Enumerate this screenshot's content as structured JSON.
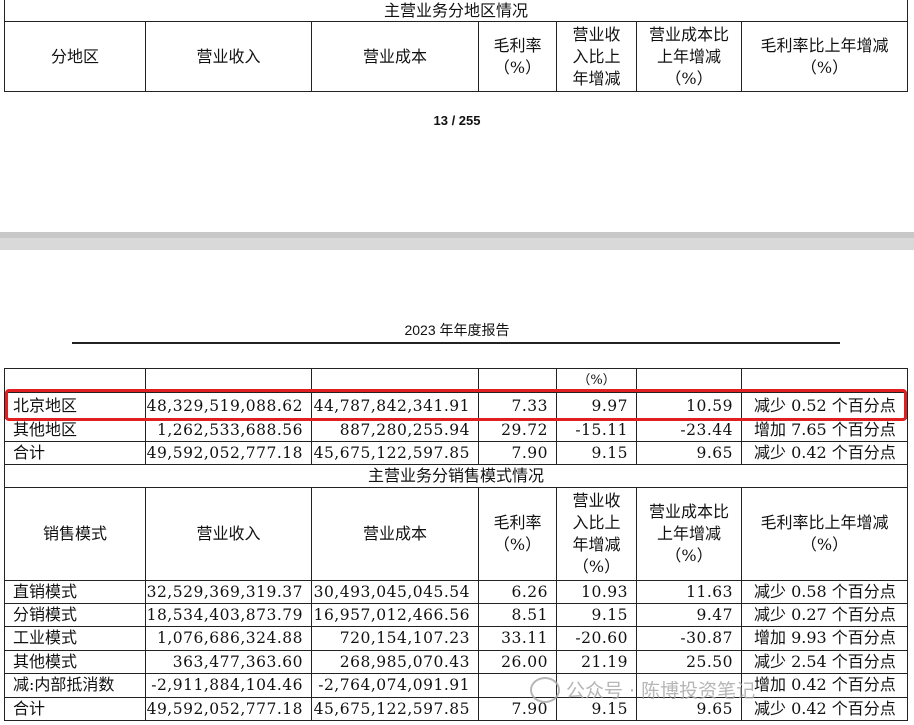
{
  "top_table": {
    "title": "主营业务分地区情况",
    "headers": [
      "分地区",
      "营业收入",
      "营业成本",
      "毛利率\n（%）",
      "营业收\n入比上\n年增减",
      "营业成本比\n上年增减\n（%）",
      "毛利率比上年增减\n（%）"
    ]
  },
  "page_number": "13 / 255",
  "report_header": "2023 年年度报告",
  "region_table": {
    "partial_header_pct": "（%）",
    "rows": [
      [
        "北京地区",
        "48,329,519,088.62",
        "44,787,842,341.91",
        "7.33",
        "9.97",
        "10.59",
        "减少 0.52 个百分点"
      ],
      [
        "其他地区",
        "1,262,533,688.56",
        "887,280,255.94",
        "29.72",
        "-15.11",
        "-23.44",
        "增加 7.65 个百分点"
      ],
      [
        "合计",
        "49,592,052,777.18",
        "45,675,122,597.85",
        "7.90",
        "9.15",
        "9.65",
        "减少 0.42 个百分点"
      ]
    ]
  },
  "sales_table": {
    "title": "主营业务分销售模式情况",
    "headers": [
      "销售模式",
      "营业收入",
      "营业成本",
      "毛利率\n（%）",
      "营业收\n入比上\n年增减\n（%）",
      "营业成本比\n上年增减\n（%）",
      "毛利率比上年增减\n（%）"
    ],
    "rows": [
      [
        "直销模式",
        "32,529,369,319.37",
        "30,493,045,045.54",
        "6.26",
        "10.93",
        "11.63",
        "减少 0.58 个百分点"
      ],
      [
        "分销模式",
        "18,534,403,873.79",
        "16,957,012,466.56",
        "8.51",
        "9.15",
        "9.47",
        "减少 0.27 个百分点"
      ],
      [
        "工业模式",
        "1,076,686,324.88",
        "720,154,107.23",
        "33.11",
        "-20.60",
        "-30.87",
        "增加 9.93 个百分点"
      ],
      [
        "其他模式",
        "363,477,363.60",
        "268,985,070.43",
        "26.00",
        "21.19",
        "25.50",
        "减少 2.54 个百分点"
      ],
      [
        "减:内部抵消数",
        "-2,911,884,104.46",
        "-2,764,074,091.91",
        "",
        "",
        "",
        "增加 0.42 个百分点"
      ],
      [
        "合计",
        "49,592,052,777.18",
        "45,675,122,597.85",
        "7.90",
        "9.15",
        "9.65",
        "减少 0.42 个百分点"
      ]
    ]
  },
  "watermark": "公众号 · 陈博投资笔记"
}
